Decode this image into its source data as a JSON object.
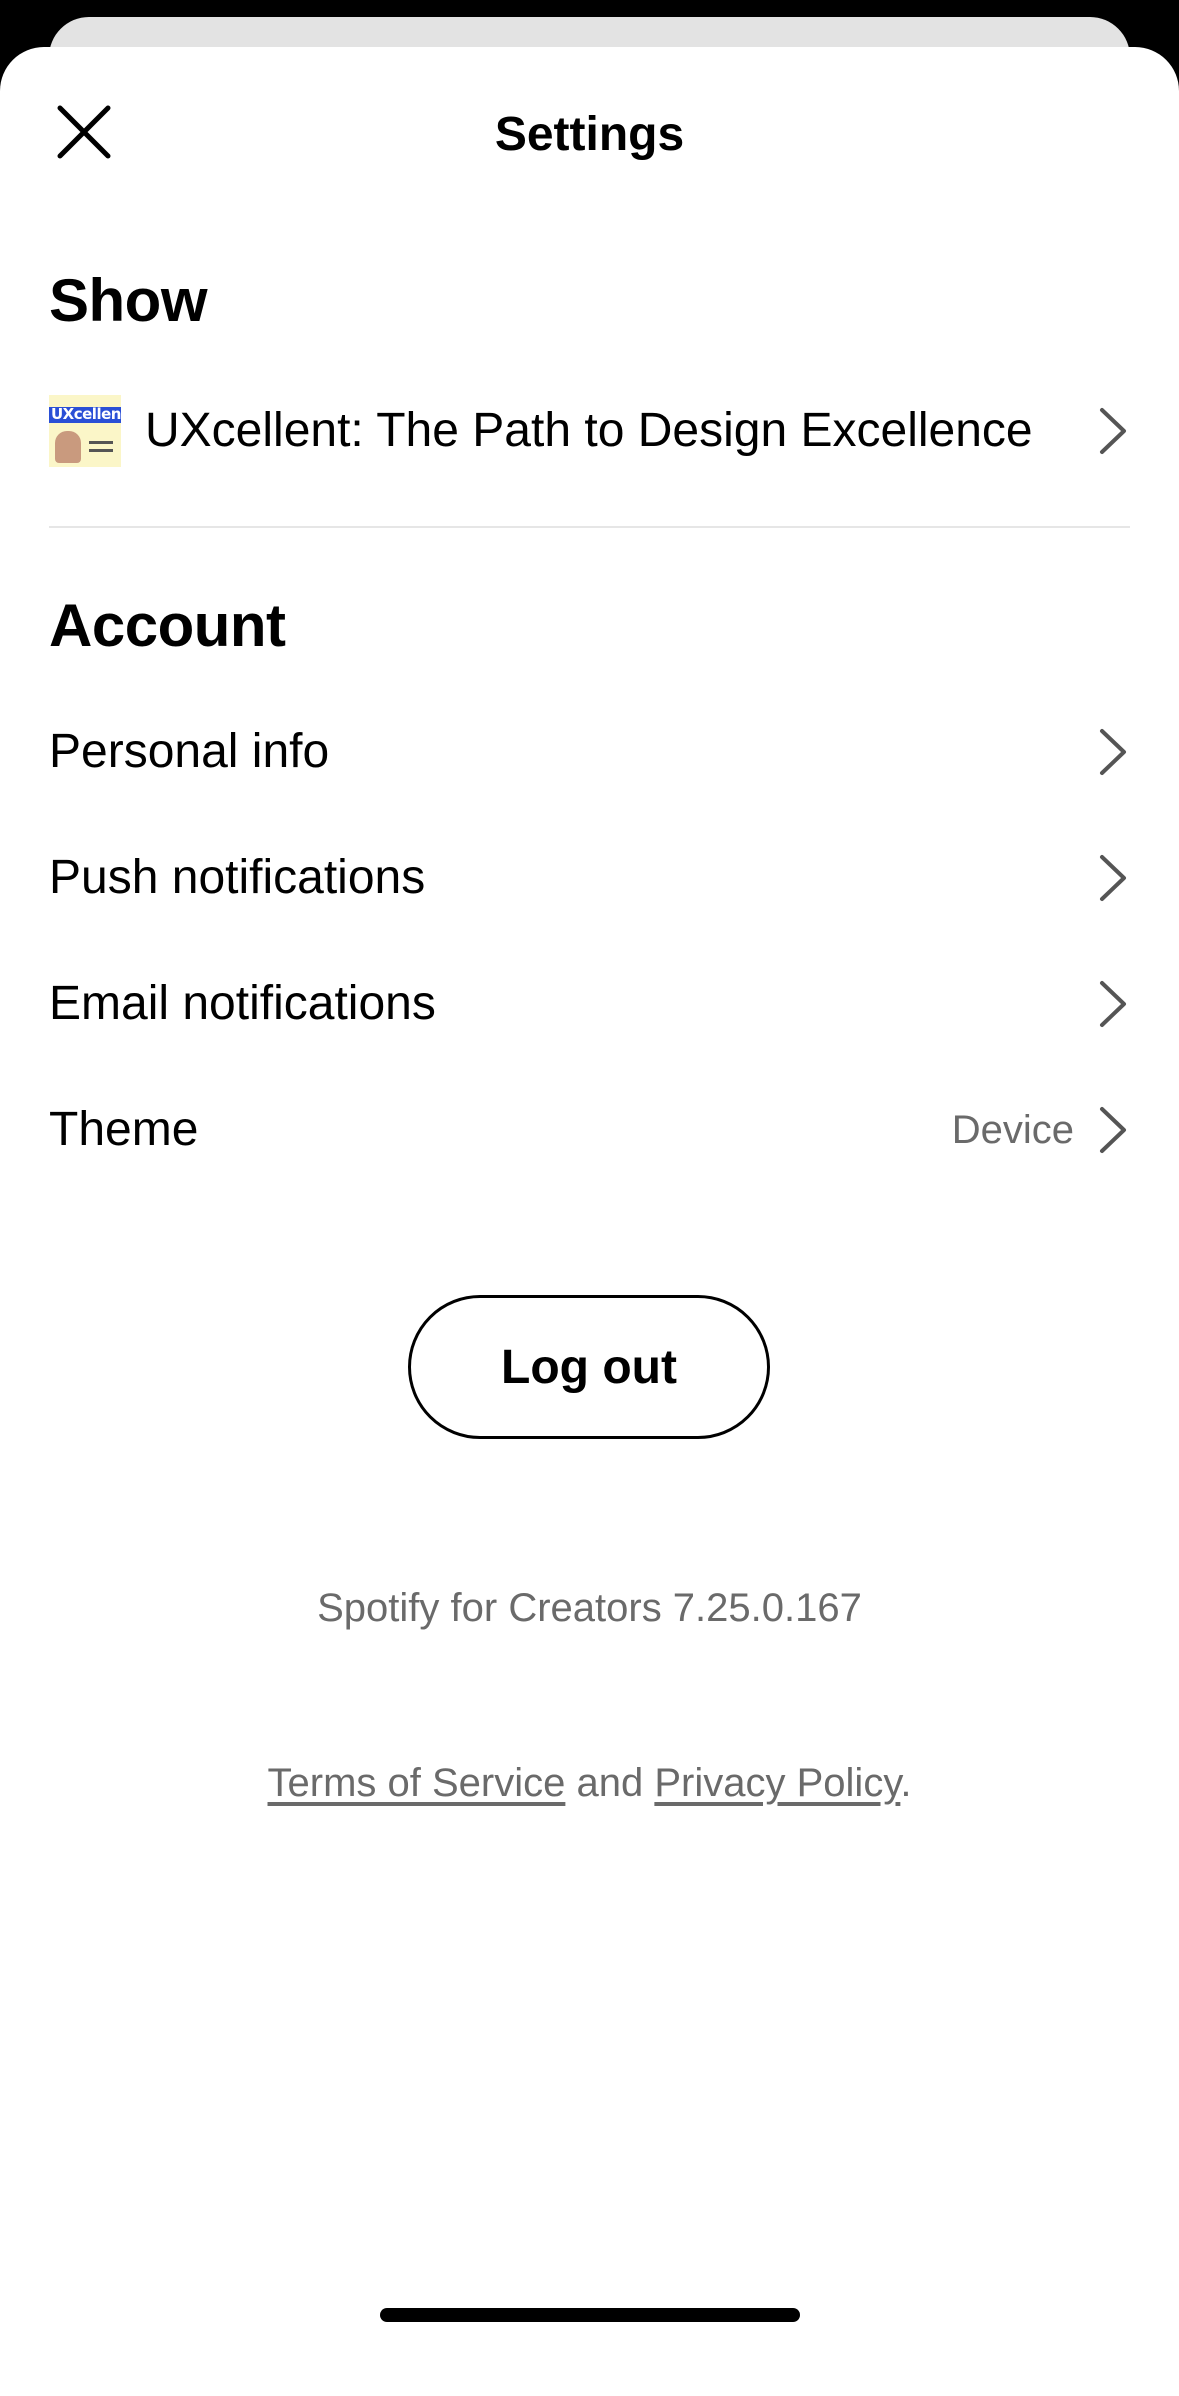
{
  "header": {
    "title": "Settings",
    "close_icon": "close-icon"
  },
  "show_section": {
    "heading": "Show",
    "show": {
      "title": "UXcellent: The Path to Design Excellence",
      "art_text": "UXcellent"
    }
  },
  "account_section": {
    "heading": "Account",
    "items": [
      {
        "label": "Personal info"
      },
      {
        "label": "Push notifications"
      },
      {
        "label": "Email notifications"
      },
      {
        "label": "Theme",
        "value": "Device"
      }
    ]
  },
  "logout_label": "Log out",
  "footer": {
    "version": "Spotify for Creators 7.25.0.167",
    "terms": "Terms of Service",
    "and": "and",
    "privacy": "Privacy Policy",
    "period": "."
  },
  "colors": {
    "text": "#000000",
    "secondary_text": "#6a6a6a",
    "divider": "#e6e6e6",
    "background": "#ffffff"
  }
}
